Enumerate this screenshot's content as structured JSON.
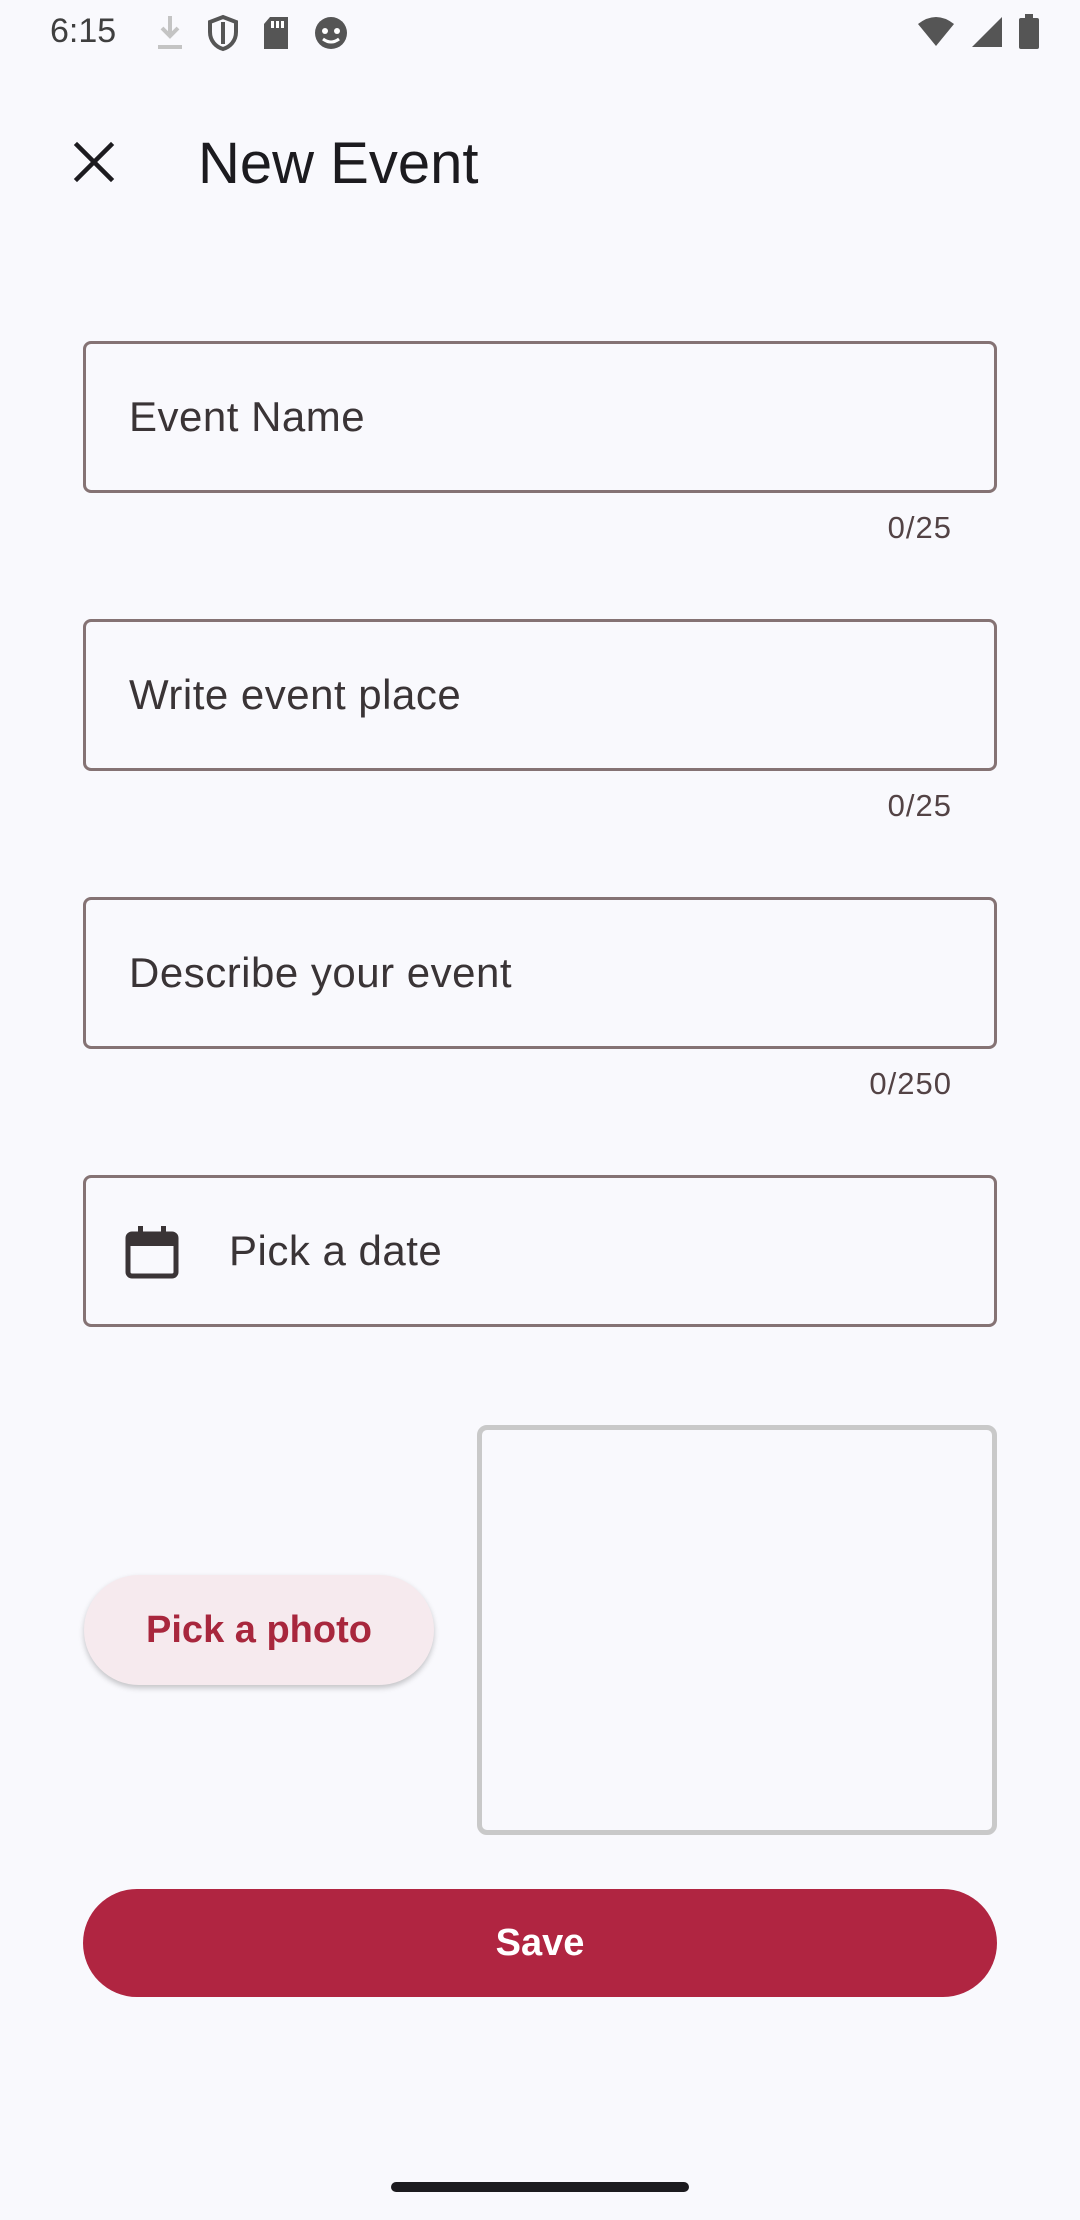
{
  "status_bar": {
    "time": "6:15",
    "left_icons": [
      "download-icon",
      "shield-icon",
      "sd-card-icon",
      "android-icon"
    ],
    "right_icons": [
      "wifi-icon",
      "signal-icon",
      "battery-icon"
    ]
  },
  "app_bar": {
    "title": "New Event",
    "close_icon": "close-icon"
  },
  "form": {
    "event_name": {
      "placeholder": "Event Name",
      "value": "",
      "counter": "0/25"
    },
    "event_place": {
      "placeholder": "Write event place",
      "value": "",
      "counter": "0/25"
    },
    "description": {
      "placeholder": "Describe your event",
      "value": "",
      "counter": "0/250"
    },
    "date": {
      "placeholder": "Pick a date",
      "icon": "calendar-icon"
    }
  },
  "photo": {
    "button_label": "Pick a photo"
  },
  "save_label": "Save",
  "colors": {
    "primary": "#b02541",
    "background": "#f9f9fd",
    "outline": "#857374",
    "tonal_button": "#f6eaee"
  }
}
